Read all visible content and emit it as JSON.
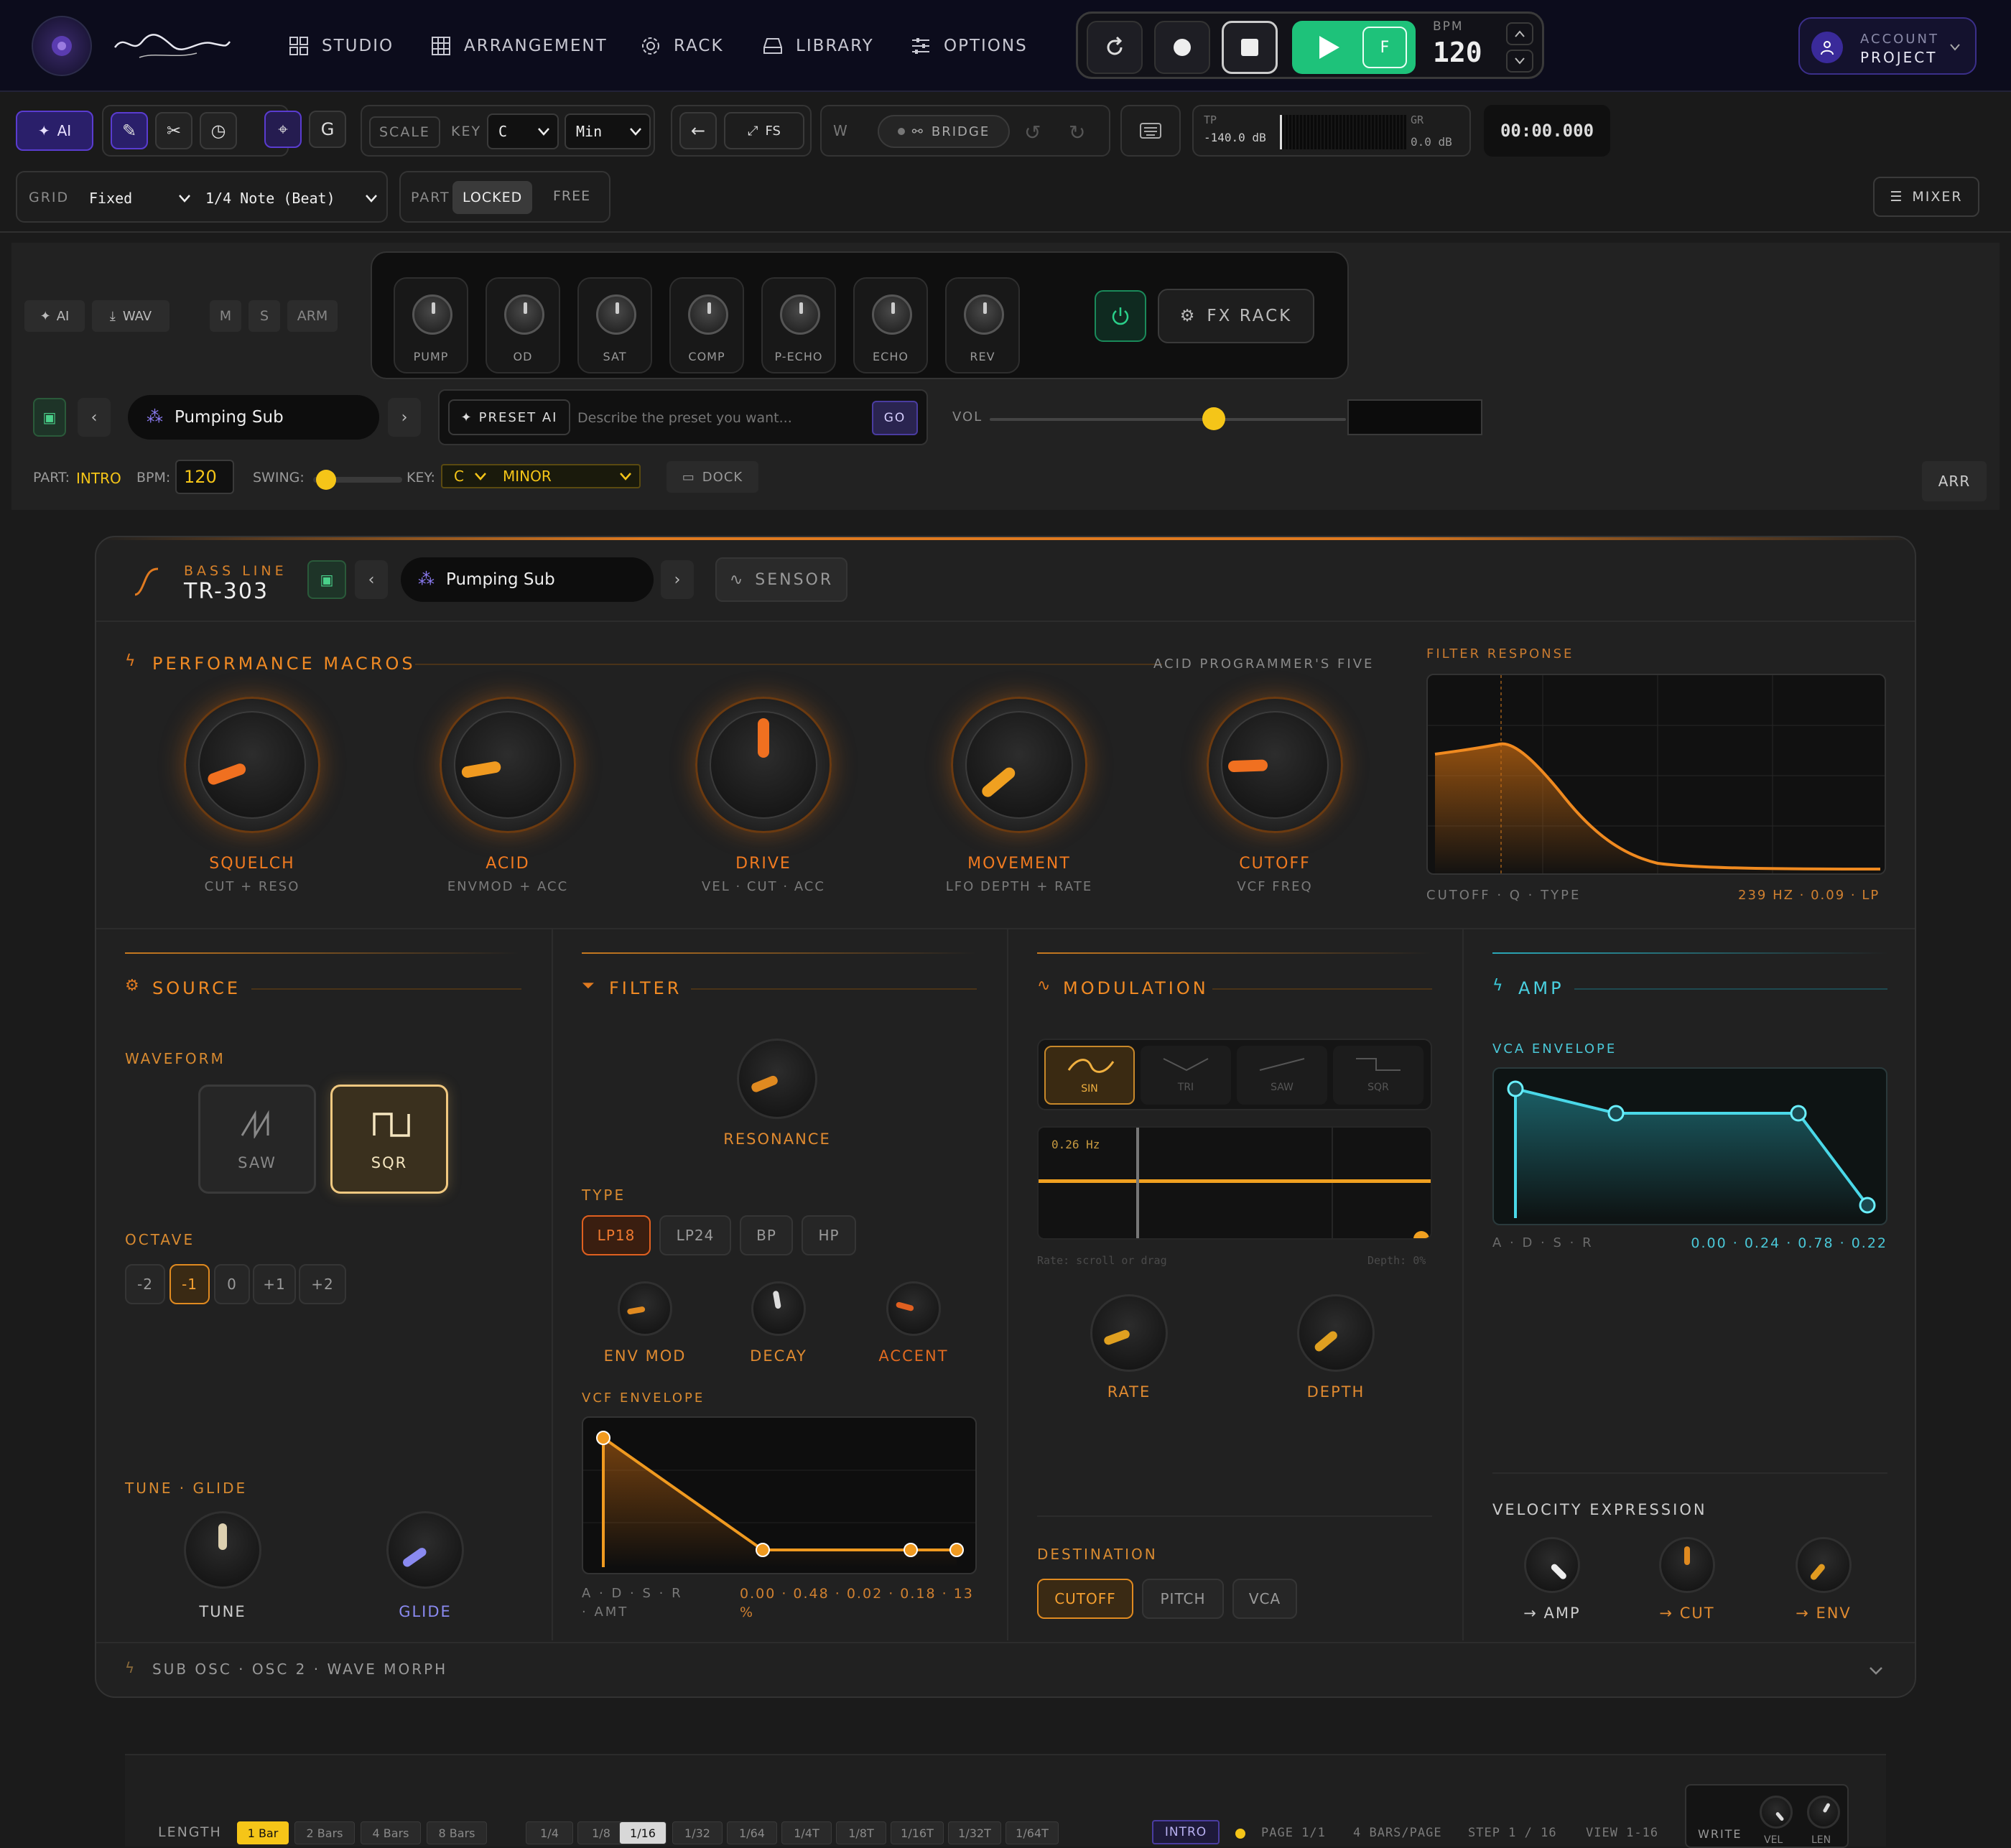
{
  "nav": {
    "items": [
      "STUDIO",
      "ARRANGEMENT",
      "RACK",
      "LIBRARY",
      "OPTIONS"
    ],
    "bpm_label": "BPM",
    "bpm_value": "120",
    "f_label": "F",
    "account_label": "ACCOUNT",
    "project_label": "PROJECT"
  },
  "toolbar": {
    "ai_label": "AI",
    "g_label": "G",
    "scale_label": "SCALE",
    "key_label": "KEY",
    "key_value": "C",
    "mode_value": "Min",
    "fs_label": "FS",
    "w_label": "W",
    "bridge_label": "BRIDGE",
    "tp_label": "TP",
    "tp_value": "-140.0 dB",
    "gr_label": "GR",
    "gr_value": "0.0 dB",
    "time": "00:00.000",
    "grid_label": "GRID",
    "grid_mode": "Fixed",
    "grid_value": "1/4 Note (Beat)",
    "part_label": "PART",
    "locked_label": "LOCKED",
    "free_label": "FREE",
    "mixer_label": "MIXER"
  },
  "track": {
    "ai_label": "AI",
    "wav_label": "WAV",
    "m_label": "M",
    "s_label": "S",
    "arm_label": "ARM",
    "fx_knobs": [
      "PUMP",
      "OD",
      "SAT",
      "COMP",
      "P-ECHO",
      "ECHO",
      "REV"
    ],
    "fx_rack_label": "FX RACK",
    "preset_name": "Pumping Sub",
    "preset_ai_label": "PRESET AI",
    "preset_placeholder": "Describe the preset you want...",
    "go_label": "GO",
    "vol_label": "VOL",
    "vol_level": 0.63,
    "part_label": "PART:",
    "part_value": "INTRO",
    "bpm_label": "BPM:",
    "bpm_value": "120",
    "swing_label": "SWING:",
    "key_label": "KEY:",
    "key_value": "C",
    "scale_value": "MINOR",
    "dock_label": "DOCK",
    "arr_label": "ARR"
  },
  "synth": {
    "category": "BASS LINE",
    "name": "TR-303",
    "preset_name": "Pumping Sub",
    "sensor_label": "SENSOR",
    "macros_title": "PERFORMANCE MACROS",
    "macros_sub": "ACID PROGRAMMER'S FIVE",
    "macros": [
      {
        "label": "SQUELCH",
        "sub": "CUT + RESO"
      },
      {
        "label": "ACID",
        "sub": "ENVMOD + ACC"
      },
      {
        "label": "DRIVE",
        "sub": "VEL · CUT · ACC"
      },
      {
        "label": "MOVEMENT",
        "sub": "LFO DEPTH + RATE"
      },
      {
        "label": "CUTOFF",
        "sub": "VCF FREQ"
      }
    ],
    "filter_response_title": "FILTER RESPONSE",
    "filter_response_left": "CUTOFF · Q · TYPE",
    "filter_response_right": "239 HZ · 0.09 · LP",
    "source_title": "SOURCE",
    "waveform_label": "WAVEFORM",
    "waveforms": [
      "SAW",
      "SQR"
    ],
    "octave_label": "OCTAVE",
    "octaves": [
      "-2",
      "-1",
      "0",
      "+1",
      "+2"
    ],
    "tune_glide_label": "TUNE · GLIDE",
    "tune_label": "TUNE",
    "glide_label": "GLIDE",
    "filter_title": "FILTER",
    "resonance_label": "RESONANCE",
    "type_label": "TYPE",
    "filter_types": [
      "LP18",
      "LP24",
      "BP",
      "HP"
    ],
    "env_mod_label": "ENV MOD",
    "decay_label": "DECAY",
    "accent_label": "ACCENT",
    "vcf_env_label": "VCF ENVELOPE",
    "vcf_env_keys": "A · D · S · R · AMT",
    "vcf_env_values": "0.00 · 0.48 · 0.02 · 0.18 · 13 %",
    "mod_title": "MODULATION",
    "lfo_shapes": [
      "SIN",
      "TRI",
      "SAW",
      "SQR"
    ],
    "lfo_rate_readout": "0.26 Hz",
    "lfo_hint": "Rate: scroll or drag",
    "lfo_depth": "Depth: 0%",
    "rate_label": "RATE",
    "depth_label": "DEPTH",
    "destination_label": "DESTINATION",
    "destinations": [
      "CUTOFF",
      "PITCH",
      "VCA"
    ],
    "amp_title": "AMP",
    "vca_env_label": "VCA ENVELOPE",
    "vca_env_keys": "A · D · S · R",
    "vca_env_values": "0.00 · 0.24 · 0.78 · 0.22",
    "velocity_label": "VELOCITY EXPRESSION",
    "vel_amp": "→ AMP",
    "vel_cut": "→ CUT",
    "vel_env": "→ ENV",
    "footer_label": "SUB OSC · OSC 2 · WAVE MORPH"
  },
  "bottom": {
    "length_label": "LENGTH",
    "lengths": [
      "1 Bar",
      "2 Bars",
      "4 Bars",
      "8 Bars"
    ],
    "divisions": [
      "1/4",
      "1/8",
      "1/16",
      "1/32",
      "1/64",
      "1/4T",
      "1/8T",
      "1/16T",
      "1/32T",
      "1/64T"
    ],
    "part_badge": "INTRO",
    "page": "PAGE 1/1",
    "bars_per_page": "4 BARS/PAGE",
    "step": "STEP 1 / 16",
    "view": "VIEW 1-16",
    "write_label": "WRITE",
    "vel_label": "VEL",
    "len_label": "LEN"
  }
}
